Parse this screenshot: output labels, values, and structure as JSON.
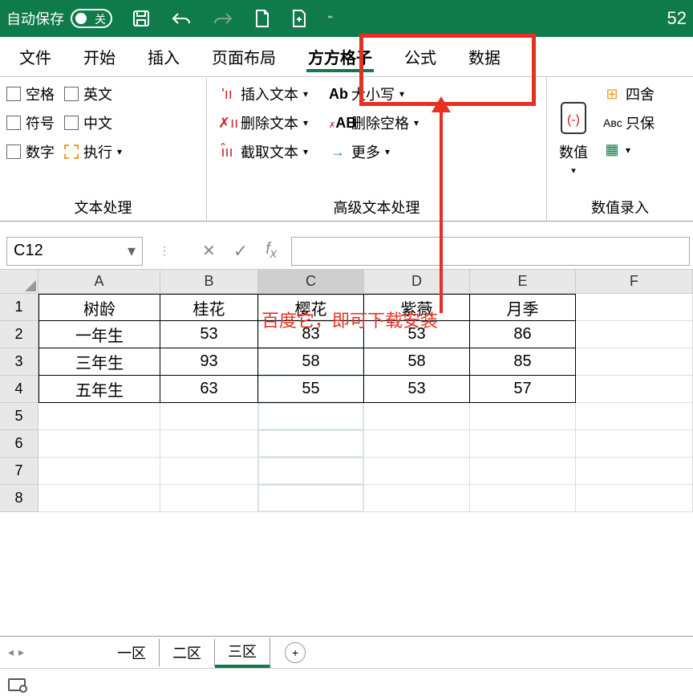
{
  "titlebar": {
    "autosave_label": "自动保存",
    "autosave_state": "关",
    "right_number": "52"
  },
  "tabs": {
    "file": "文件",
    "home": "开始",
    "insert": "插入",
    "layout": "页面布局",
    "ffgz": "方方格子",
    "formula": "公式",
    "data": "数据"
  },
  "ribbon": {
    "g1": {
      "label": "文本处理",
      "space": "空格",
      "symbol": "符号",
      "number": "数字",
      "english": "英文",
      "chinese": "中文",
      "execute": "执行"
    },
    "g2": {
      "label": "高级文本处理",
      "insert_text": "插入文本",
      "delete_text": "删除文本",
      "extract_text": "截取文本",
      "case": "大小写",
      "del_space": "删除空格",
      "more": "更多"
    },
    "g3": {
      "label": "数值录入",
      "numeric": "数值",
      "round": "四舍",
      "keep": "只保"
    }
  },
  "annotation": "百度它，即可下载安装",
  "namebox": "C12",
  "columns": [
    "A",
    "B",
    "C",
    "D",
    "E",
    "F"
  ],
  "row_headers": [
    "1",
    "2",
    "3",
    "4",
    "5",
    "6",
    "7",
    "8"
  ],
  "table": {
    "head": [
      "树龄",
      "桂花",
      "樱花",
      "紫薇",
      "月季"
    ],
    "rows": [
      [
        "一年生",
        "53",
        "83",
        "53",
        "86"
      ],
      [
        "三年生",
        "93",
        "58",
        "58",
        "85"
      ],
      [
        "五年生",
        "63",
        "55",
        "53",
        "57"
      ]
    ]
  },
  "sheets": {
    "s1": "一区",
    "s2": "二区",
    "s3": "三区"
  },
  "chart_data": {
    "type": "table",
    "title": "",
    "columns": [
      "树龄",
      "桂花",
      "樱花",
      "紫薇",
      "月季"
    ],
    "rows": [
      {
        "树龄": "一年生",
        "桂花": 53,
        "樱花": 83,
        "紫薇": 53,
        "月季": 86
      },
      {
        "树龄": "三年生",
        "桂花": 93,
        "樱花": 58,
        "紫薇": 58,
        "月季": 85
      },
      {
        "树龄": "五年生",
        "桂花": 63,
        "樱花": 55,
        "紫薇": 53,
        "月季": 57
      }
    ]
  }
}
